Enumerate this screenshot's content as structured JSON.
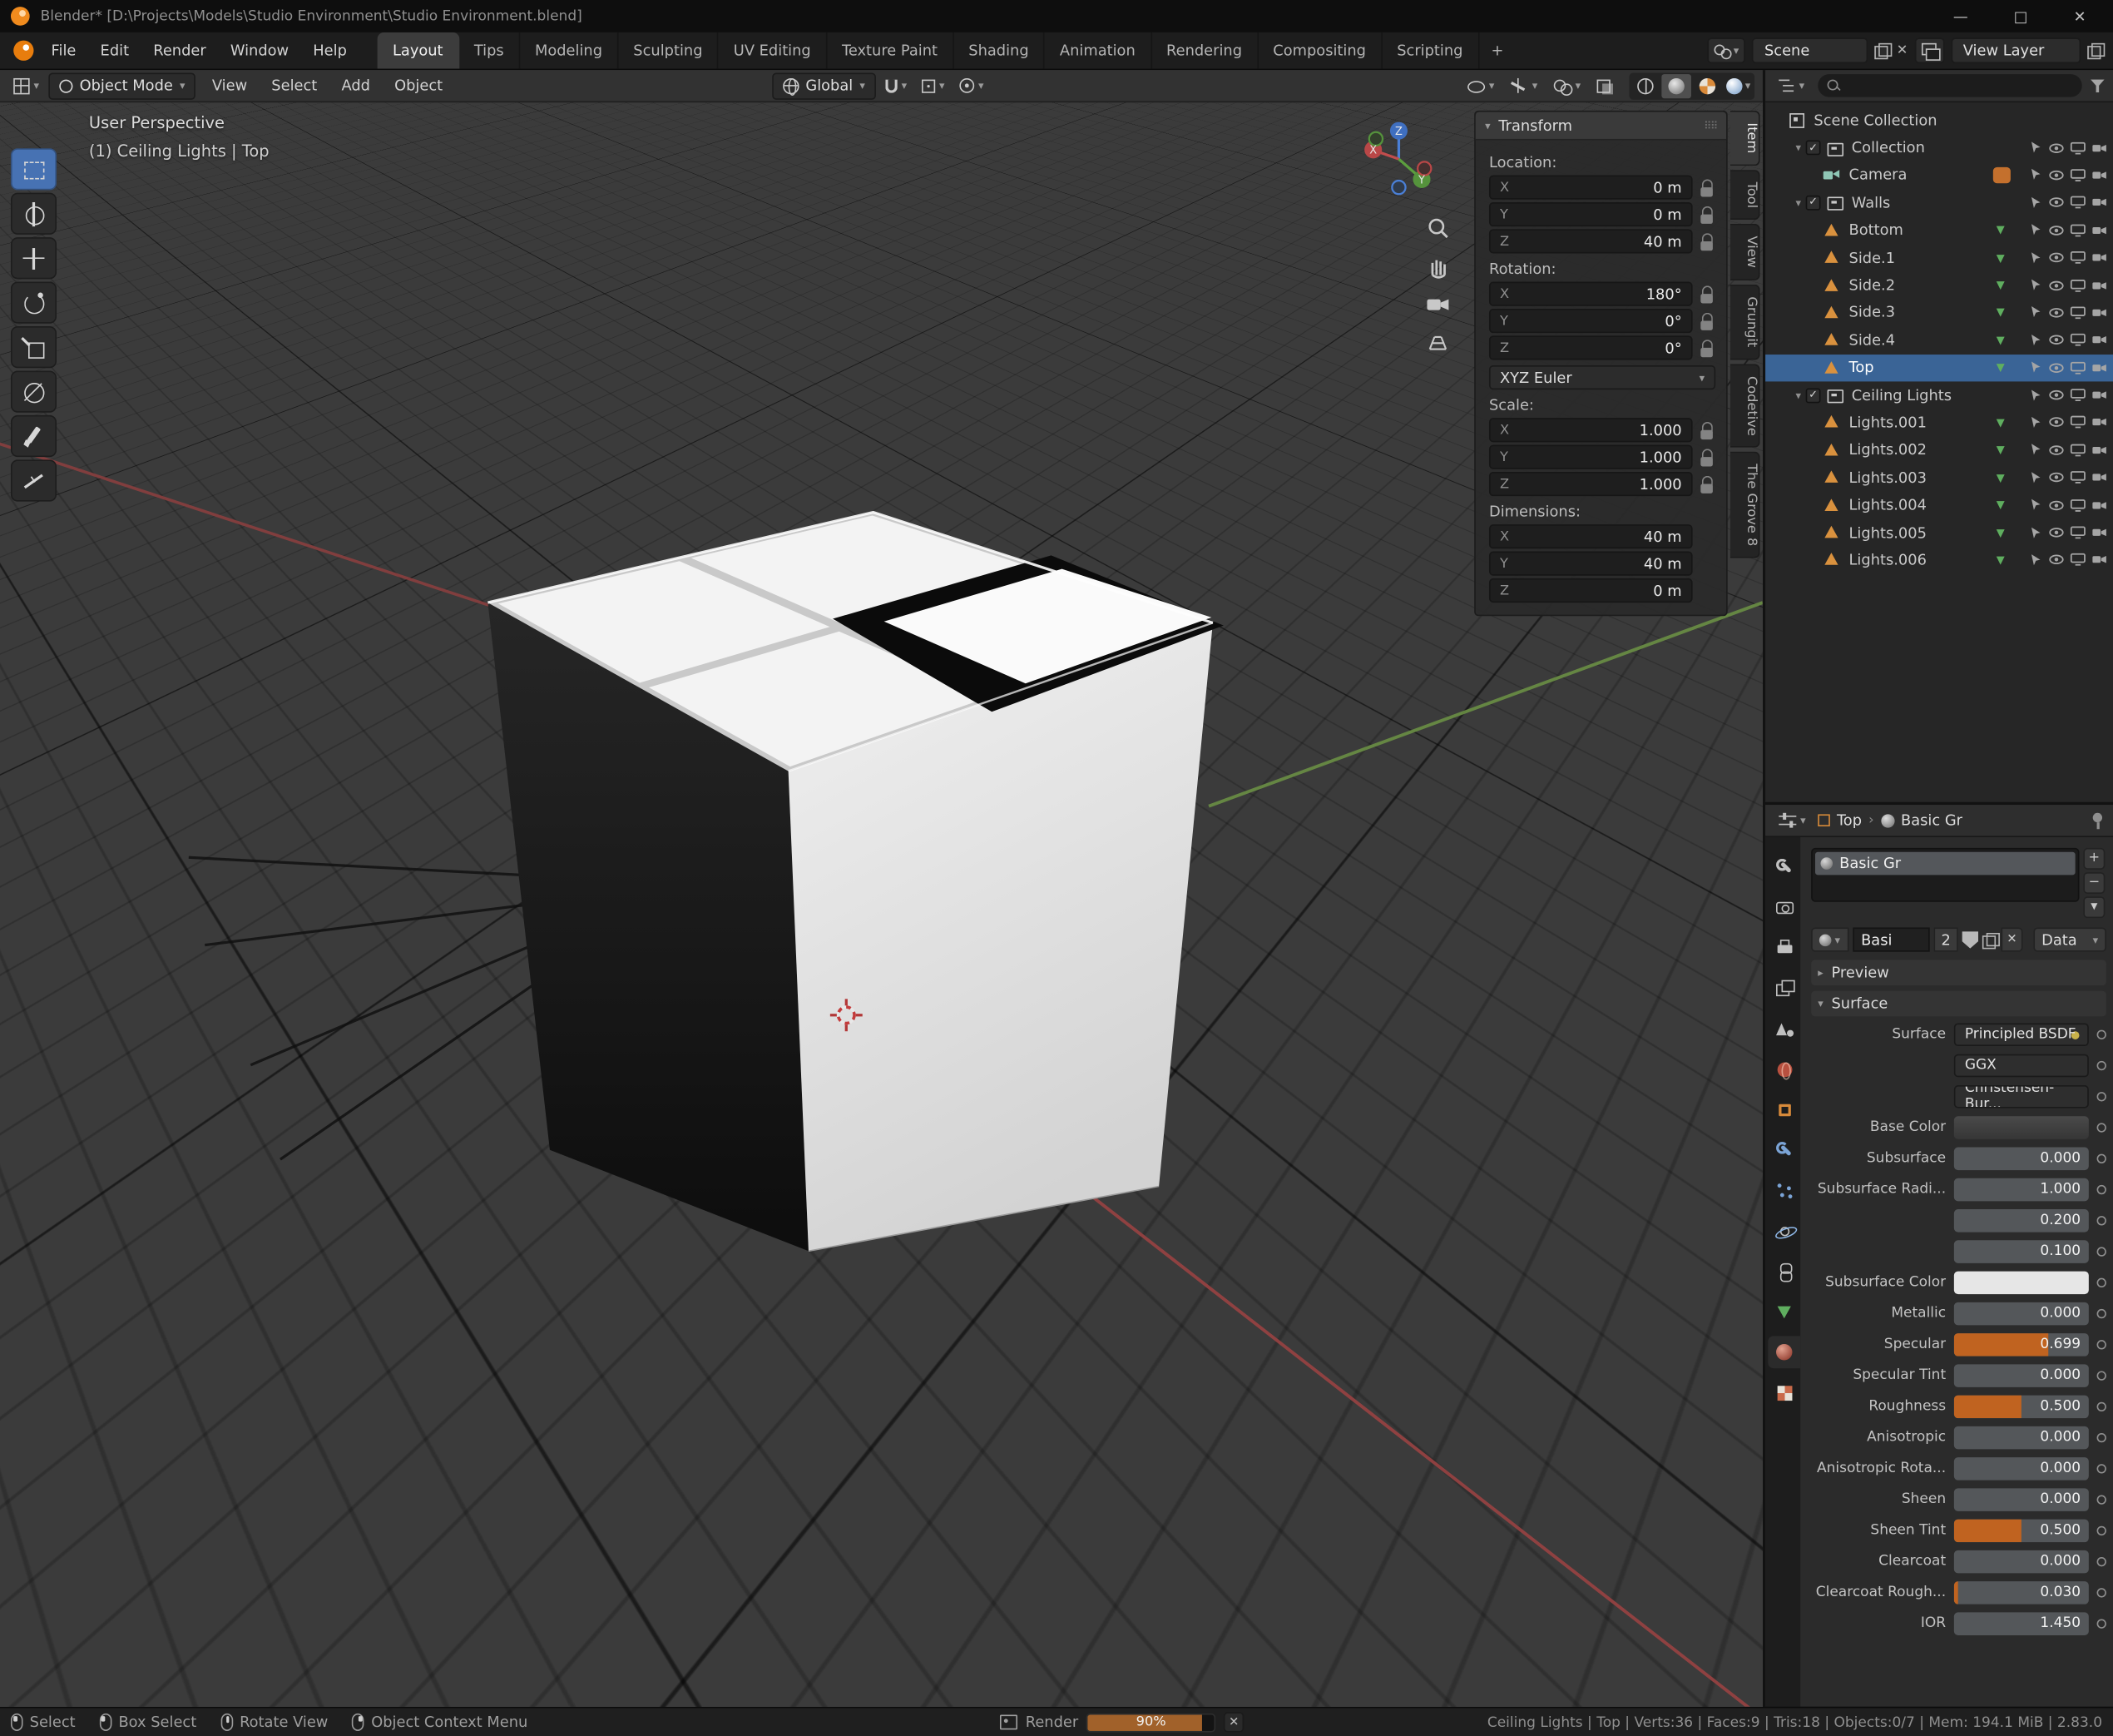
{
  "window": {
    "title": "Blender* [D:\\Projects\\Models\\Studio Environment\\Studio Environment.blend]"
  },
  "icons": {
    "dropdown": "▾",
    "expand": "▾",
    "collapse": "▸",
    "chevron": "›",
    "close": "✕",
    "plus": "+",
    "minus": "−",
    "check": "✓",
    "grip": "⠿⠿",
    "minimize": "—",
    "maximize": "□",
    "mesh_data": "▼",
    "updown": "▾"
  },
  "topbar": {
    "menus": [
      "File",
      "Edit",
      "Render",
      "Window",
      "Help"
    ],
    "workspaces": [
      {
        "label": "Layout",
        "active": true
      },
      {
        "label": "Tips"
      },
      {
        "label": "Modeling"
      },
      {
        "label": "Sculpting"
      },
      {
        "label": "UV Editing"
      },
      {
        "label": "Texture Paint"
      },
      {
        "label": "Shading"
      },
      {
        "label": "Animation"
      },
      {
        "label": "Rendering"
      },
      {
        "label": "Compositing"
      },
      {
        "label": "Scripting"
      }
    ],
    "scene": "Scene",
    "view_layer": "View Layer"
  },
  "viewport": {
    "header": {
      "mode": "Object Mode",
      "menus": [
        "View",
        "Select",
        "Add",
        "Object"
      ],
      "orientation": "Global"
    },
    "overlay": {
      "perspective_label": "User Perspective",
      "context_label": "(1) Ceiling Lights | Top"
    },
    "gizmo_axes": {
      "x": "X",
      "y": "Y",
      "z": "Z"
    },
    "toolbar": [
      {
        "type": "box-select",
        "active": true
      },
      {
        "type": "cursor"
      },
      {
        "type": "move"
      },
      {
        "type": "rotate"
      },
      {
        "type": "scale"
      },
      {
        "type": "transform"
      },
      {
        "type": "annotate"
      },
      {
        "type": "measure"
      }
    ],
    "sidebar_tabs": [
      {
        "label": "Item",
        "active": true
      },
      {
        "label": "Tool"
      },
      {
        "label": "View"
      },
      {
        "label": "Grungit"
      },
      {
        "label": "Codetive"
      },
      {
        "label": "The Grove 8"
      }
    ],
    "transform_panel": {
      "title": "Transform",
      "location_label": "Location:",
      "location_rows": [
        {
          "axis": "X",
          "value": "0 m",
          "type": "lock"
        },
        {
          "axis": "Y",
          "value": "0 m",
          "type": "lock"
        },
        {
          "axis": "Z",
          "value": "40 m",
          "type": "lock"
        }
      ],
      "rotation_label": "Rotation:",
      "rotation_rows": [
        {
          "axis": "X",
          "value": "180°",
          "type": "lock"
        },
        {
          "axis": "Y",
          "value": "0°",
          "type": "lock"
        },
        {
          "axis": "Z",
          "value": "0°",
          "type": "lock"
        }
      ],
      "rotation_mode": "XYZ Euler",
      "scale_label": "Scale:",
      "scale_rows": [
        {
          "axis": "X",
          "value": "1.000",
          "type": "lock"
        },
        {
          "axis": "Y",
          "value": "1.000",
          "type": "lock"
        },
        {
          "axis": "Z",
          "value": "1.000",
          "type": "lock"
        }
      ],
      "dimensions_label": "Dimensions:",
      "dimension_rows": [
        {
          "axis": "X",
          "value": "40 m",
          "type": "plain"
        },
        {
          "axis": "Y",
          "value": "40 m",
          "type": "plain"
        },
        {
          "axis": "Z",
          "value": "0 m",
          "type": "plain"
        }
      ]
    }
  },
  "outliner": {
    "rows": [
      {
        "label": "Scene Collection",
        "indent": 0,
        "type": "scene"
      },
      {
        "label": "Collection",
        "indent": 1,
        "type": "collection"
      },
      {
        "label": "Camera",
        "indent": 2,
        "type": "camera"
      },
      {
        "label": "Walls",
        "indent": 1,
        "type": "collection"
      },
      {
        "label": "Bottom",
        "indent": 2,
        "type": "mesh"
      },
      {
        "label": "Side.1",
        "indent": 2,
        "type": "mesh"
      },
      {
        "label": "Side.2",
        "indent": 2,
        "type": "mesh"
      },
      {
        "label": "Side.3",
        "indent": 2,
        "type": "mesh"
      },
      {
        "label": "Side.4",
        "indent": 2,
        "type": "mesh"
      },
      {
        "label": "Top",
        "indent": 2,
        "type": "mesh",
        "selected": true
      },
      {
        "label": "Ceiling Lights",
        "indent": 1,
        "type": "collection"
      },
      {
        "label": "Lights.001",
        "indent": 2,
        "type": "mesh"
      },
      {
        "label": "Lights.002",
        "indent": 2,
        "type": "mesh"
      },
      {
        "label": "Lights.003",
        "indent": 2,
        "type": "mesh"
      },
      {
        "label": "Lights.004",
        "indent": 2,
        "type": "mesh"
      },
      {
        "label": "Lights.005",
        "indent": 2,
        "type": "mesh"
      },
      {
        "label": "Lights.006",
        "indent": 2,
        "type": "mesh"
      }
    ]
  },
  "properties": {
    "breadcrumb": {
      "object": "Top",
      "material": "Basic Gr"
    },
    "tabs": [
      {
        "type": "tool"
      },
      {
        "type": "render"
      },
      {
        "type": "output"
      },
      {
        "type": "viewlayer"
      },
      {
        "type": "scene"
      },
      {
        "type": "world"
      },
      {
        "type": "object"
      },
      {
        "type": "modifier"
      },
      {
        "type": "particles"
      },
      {
        "type": "physics"
      },
      {
        "type": "constraints"
      },
      {
        "type": "data"
      },
      {
        "type": "material",
        "active": true
      },
      {
        "type": "texture"
      }
    ],
    "material_slot": "Basic Gr",
    "datablock": {
      "name": "Basi",
      "users": "2",
      "source": "Data"
    },
    "panels": {
      "preview": "Preview",
      "surface": "Surface"
    },
    "surface_rows": [
      {
        "label": "Surface",
        "value": "Principled BSDF",
        "kind": "button"
      },
      {
        "label": "",
        "value": "GGX",
        "kind": "dropdown"
      },
      {
        "label": "",
        "value": "Christensen-Bur...",
        "kind": "dropdown"
      },
      {
        "label": "Base Color",
        "value": "",
        "kind": "color-dark"
      },
      {
        "label": "Subsurface",
        "value": "0.000",
        "kind": "slider",
        "fill": 0
      },
      {
        "label": "Subsurface Radi...",
        "value": "1.000",
        "kind": "field"
      },
      {
        "label": "",
        "value": "0.200",
        "kind": "field"
      },
      {
        "label": "",
        "value": "0.100",
        "kind": "field"
      },
      {
        "label": "Subsurface Color",
        "value": "",
        "kind": "color-light"
      },
      {
        "label": "Metallic",
        "value": "0.000",
        "kind": "slider",
        "fill": 0
      },
      {
        "label": "Specular",
        "value": "0.699",
        "kind": "slider",
        "fill": 0.699
      },
      {
        "label": "Specular Tint",
        "value": "0.000",
        "kind": "slider",
        "fill": 0
      },
      {
        "label": "Roughness",
        "value": "0.500",
        "kind": "slider",
        "fill": 0.5
      },
      {
        "label": "Anisotropic",
        "value": "0.000",
        "kind": "slider",
        "fill": 0
      },
      {
        "label": "Anisotropic Rota...",
        "value": "0.000",
        "kind": "slider",
        "fill": 0
      },
      {
        "label": "Sheen",
        "value": "0.000",
        "kind": "slider",
        "fill": 0
      },
      {
        "label": "Sheen Tint",
        "value": "0.500",
        "kind": "slider",
        "fill": 0.5
      },
      {
        "label": "Clearcoat",
        "value": "0.000",
        "kind": "slider",
        "fill": 0
      },
      {
        "label": "Clearcoat Rough...",
        "value": "0.030",
        "kind": "slider",
        "fill": 0.03
      },
      {
        "label": "IOR",
        "value": "1.450",
        "kind": "field"
      }
    ]
  },
  "statusbar": {
    "keymap": [
      {
        "label": "Select",
        "type": "left"
      },
      {
        "label": "Box Select",
        "type": "left"
      },
      {
        "label": "Rotate View",
        "type": "mid"
      },
      {
        "label": "Object Context Menu",
        "type": "right"
      }
    ],
    "render": {
      "label": "Render",
      "progress": "90%"
    },
    "info": "Ceiling Lights | Top | Verts:36 | Faces:9 | Tris:18 | Objects:0/7 | Mem: 194.1 MiB | 2.83.0"
  }
}
